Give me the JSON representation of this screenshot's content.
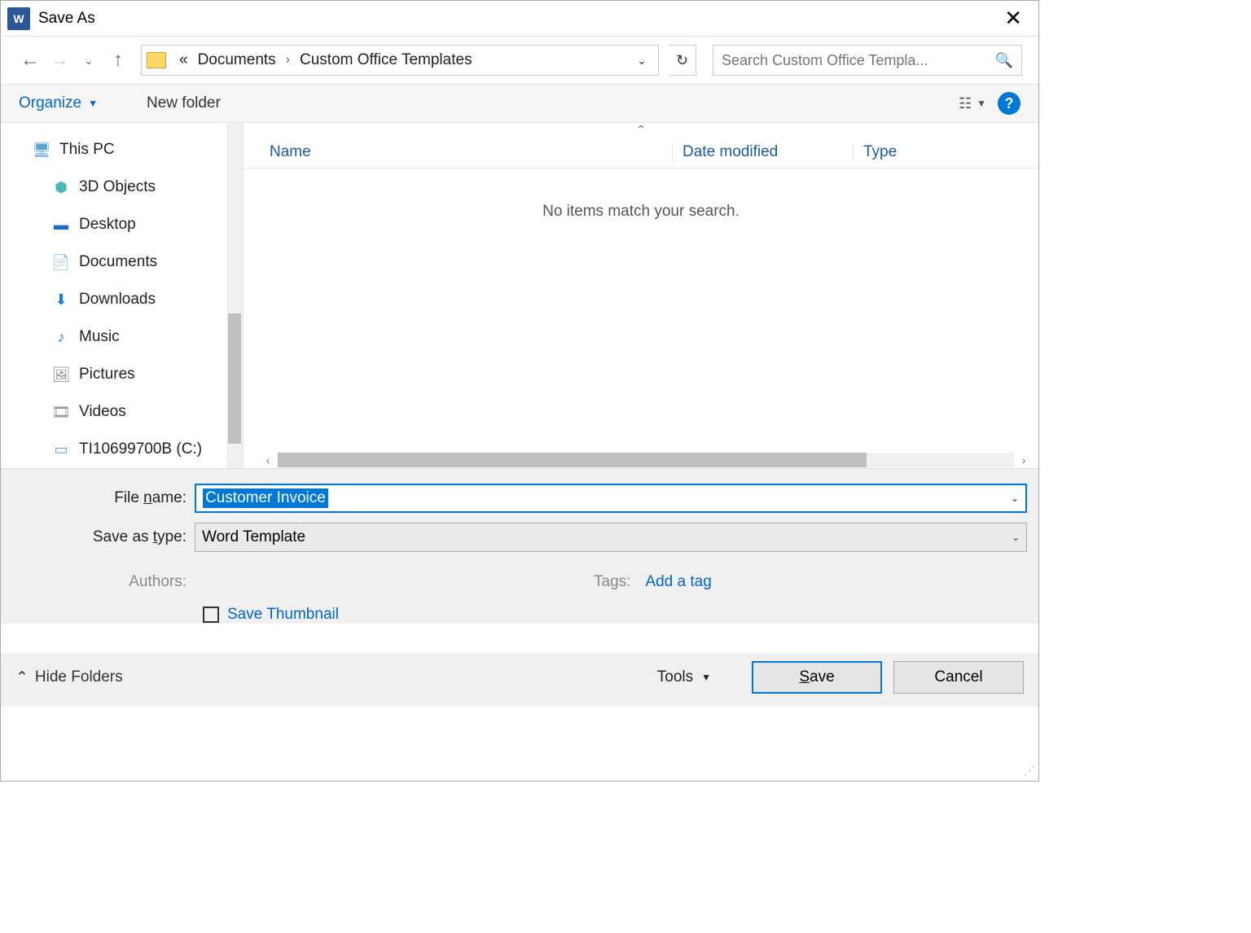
{
  "titlebar": {
    "title": "Save As"
  },
  "nav": {
    "breadcrumb_prefix": "«",
    "crumb1": "Documents",
    "crumb2": "Custom Office Templates"
  },
  "search": {
    "placeholder": "Search Custom Office Templa..."
  },
  "toolbar": {
    "organize": "Organize",
    "newfolder": "New folder"
  },
  "tree": {
    "this_pc": "This PC",
    "items": [
      {
        "label": "3D Objects"
      },
      {
        "label": "Desktop"
      },
      {
        "label": "Documents"
      },
      {
        "label": "Downloads"
      },
      {
        "label": "Music"
      },
      {
        "label": "Pictures"
      },
      {
        "label": "Videos"
      },
      {
        "label": "TI10699700B (C:)"
      }
    ]
  },
  "columns": {
    "name": "Name",
    "date": "Date modified",
    "type": "Type"
  },
  "filelist": {
    "empty": "No items match your search."
  },
  "form": {
    "filename_label": "File name:",
    "filename_value": "Customer Invoice",
    "saveastype_label": "Save as type:",
    "saveastype_value": "Word Template",
    "authors_label": "Authors:",
    "tags_label": "Tags:",
    "add_tag": "Add a tag",
    "save_thumbnail": "Save Thumbnail"
  },
  "buttons": {
    "hide_folders": "Hide Folders",
    "tools": "Tools",
    "save": "Save",
    "cancel": "Cancel"
  }
}
